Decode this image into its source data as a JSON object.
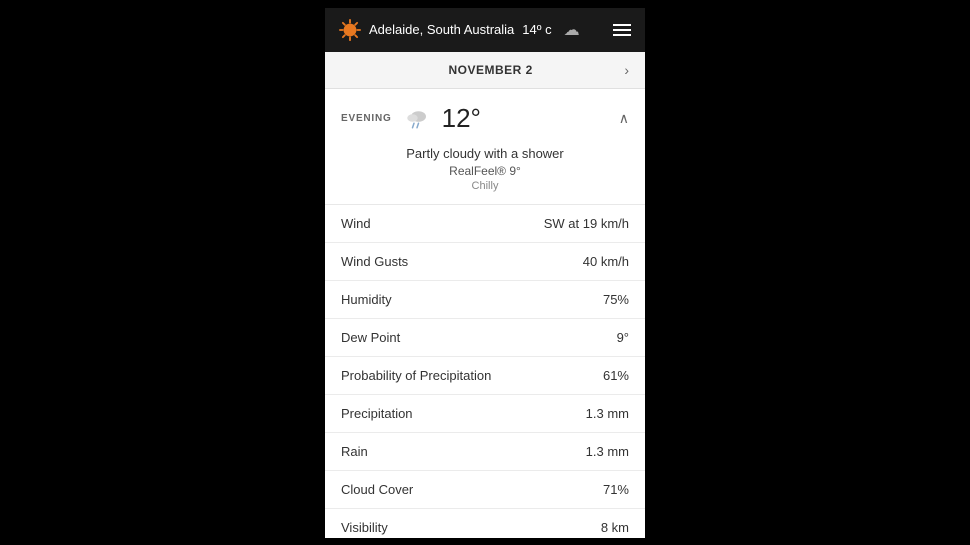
{
  "header": {
    "city": "Adelaide, South Australia",
    "temp": "14º c",
    "menu_label": "menu"
  },
  "date_bar": {
    "date": "NOVEMBER 2",
    "chevron": "›"
  },
  "evening": {
    "label": "EVENING",
    "temp": "12°",
    "description": "Partly cloudy with a shower",
    "real_feel": "RealFeel® 9°",
    "feel_label": "Chilly"
  },
  "details": [
    {
      "label": "Wind",
      "value": "SW at 19 km/h"
    },
    {
      "label": "Wind Gusts",
      "value": "40 km/h"
    },
    {
      "label": "Humidity",
      "value": "75%"
    },
    {
      "label": "Dew Point",
      "value": "9°"
    },
    {
      "label": "Probability of Precipitation",
      "value": "61%"
    },
    {
      "label": "Precipitation",
      "value": "1.3 mm"
    },
    {
      "label": "Rain",
      "value": "1.3 mm"
    },
    {
      "label": "Cloud Cover",
      "value": "71%"
    },
    {
      "label": "Visibility",
      "value": "8 km"
    }
  ],
  "icons": {
    "sun": "🔶",
    "cloud": "☁",
    "weather": "🌦"
  }
}
